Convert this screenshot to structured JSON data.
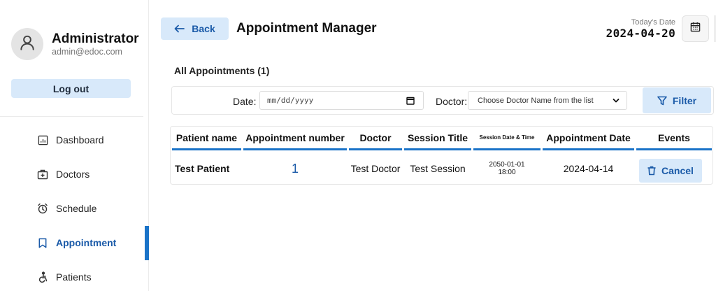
{
  "profile": {
    "name": "Administrator",
    "email": "admin@edoc.com",
    "logout_label": "Log out"
  },
  "nav": [
    {
      "label": "Dashboard",
      "icon": "dashboard-icon"
    },
    {
      "label": "Doctors",
      "icon": "doctor-bag-icon"
    },
    {
      "label": "Schedule",
      "icon": "alarm-clock-icon"
    },
    {
      "label": "Appointment",
      "icon": "bookmark-icon"
    },
    {
      "label": "Patients",
      "icon": "accessible-icon"
    }
  ],
  "active_nav": "Appointment",
  "header": {
    "back_label": "Back",
    "title": "Appointment Manager",
    "today_label": "Today's Date",
    "today_value": "2024-04-20"
  },
  "section_title": "All Appointments (1)",
  "filter": {
    "date_label": "Date:",
    "date_placeholder": "mm/dd/yyyy",
    "doctor_label": "Doctor:",
    "doctor_selected": "Choose Doctor Name from the list",
    "button_label": "Filter"
  },
  "table": {
    "headers": [
      "Patient name",
      "Appointment number",
      "Doctor",
      "Session Title",
      "Session Date & Time",
      "Appointment Date",
      "Events"
    ],
    "rows": [
      {
        "patient": "Test Patient",
        "number": "1",
        "doctor": "Test Doctor",
        "session_title": "Test Session",
        "session_date": "2050-01-01",
        "session_time": "18:00",
        "appointment_date": "2024-04-14",
        "action_label": "Cancel"
      }
    ]
  },
  "colors": {
    "accent": "#1a73c8",
    "button_bg": "#d8e9fa",
    "button_text": "#1a5aa8"
  }
}
